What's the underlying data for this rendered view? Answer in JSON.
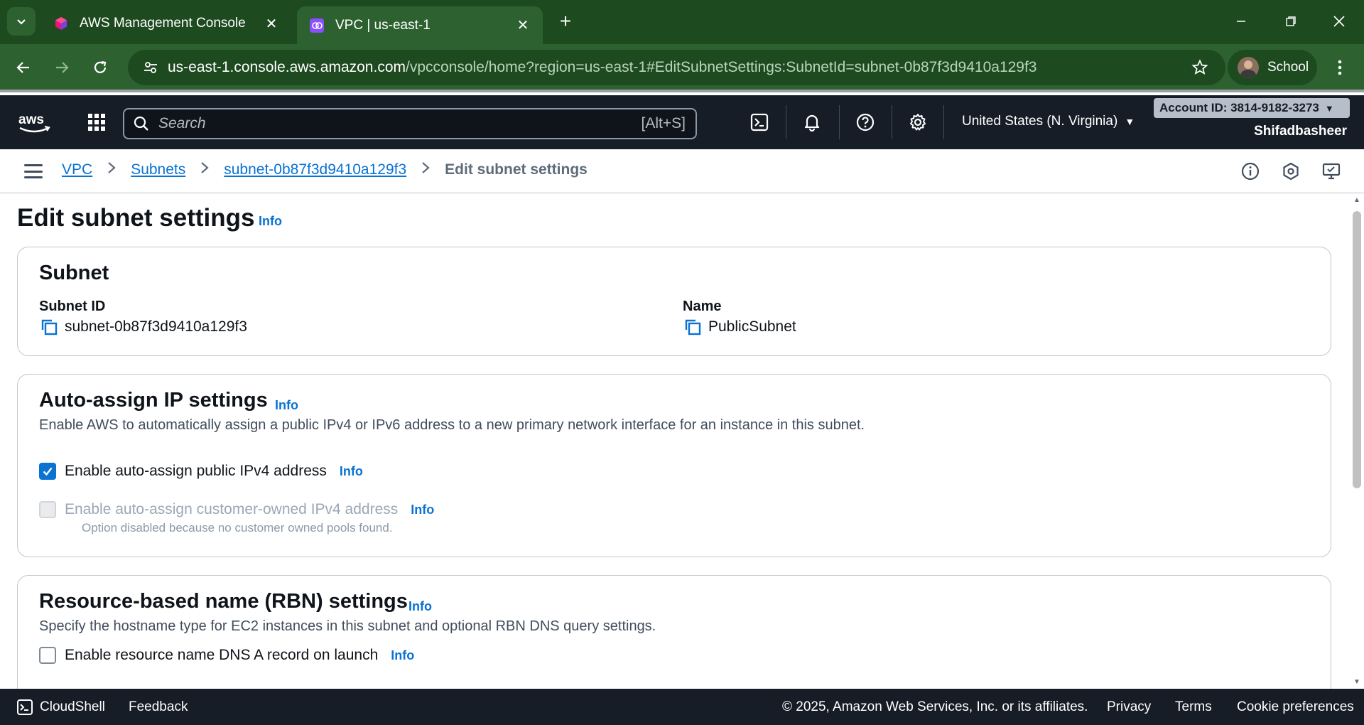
{
  "browser": {
    "tabs": [
      {
        "title": "AWS Management Console",
        "active": false
      },
      {
        "title": "VPC | us-east-1",
        "active": true
      }
    ],
    "url_host": "us-east-1.console.aws.amazon.com",
    "url_path": "/vpcconsole/home?region=us-east-1#EditSubnetSettings:SubnetId=subnet-0b87f3d9410a129f3",
    "profile_name": "School"
  },
  "aws_header": {
    "search_placeholder": "Search",
    "search_shortcut": "[Alt+S]",
    "region": "United States (N. Virginia)",
    "account_id": "Account ID: 3814-9182-3273",
    "username": "Shifadbasheer"
  },
  "breadcrumb": {
    "items": [
      "VPC",
      "Subnets",
      "subnet-0b87f3d9410a129f3"
    ],
    "current": "Edit subnet settings"
  },
  "page": {
    "title": "Edit subnet settings",
    "info": "Info"
  },
  "subnet_card": {
    "heading": "Subnet",
    "subnet_id_label": "Subnet ID",
    "subnet_id_value": "subnet-0b87f3d9410a129f3",
    "name_label": "Name",
    "name_value": "PublicSubnet"
  },
  "auto_assign_card": {
    "heading": "Auto-assign IP settings",
    "info": "Info",
    "description": "Enable AWS to automatically assign a public IPv4 or IPv6 address to a new primary network interface for an instance in this subnet.",
    "ipv4_label": "Enable auto-assign public IPv4 address",
    "ipv4_checked": true,
    "customer_owned_label": "Enable auto-assign customer-owned IPv4 address",
    "customer_owned_helper": "Option disabled because no customer owned pools found."
  },
  "rbn_card": {
    "heading": "Resource-based name (RBN) settings",
    "info": "Info",
    "description": "Specify the hostname type for EC2 instances in this subnet and optional RBN DNS query settings.",
    "dns_a_label": "Enable resource name DNS A record on launch",
    "dns_a_checked": false
  },
  "footer": {
    "cloudshell": "CloudShell",
    "feedback": "Feedback",
    "copyright": "© 2025, Amazon Web Services, Inc. or its affiliates.",
    "privacy": "Privacy",
    "terms": "Terms",
    "cookies": "Cookie preferences"
  },
  "colors": {
    "browser_frame": "#1e4a20",
    "browser_toolbar": "#2d6230",
    "aws_header": "#161d26",
    "link_blue": "#0972d3"
  },
  "icons": [
    "tab-search-icon",
    "aws-cube-icon",
    "vpc-icon",
    "close-icon",
    "plus-icon",
    "minimize-icon",
    "restore-icon",
    "back-icon",
    "forward-icon",
    "reload-icon",
    "site-info-icon",
    "star-icon",
    "kebab-icon",
    "aws-logo",
    "apps-grid-icon",
    "search-icon",
    "cloudshell-icon",
    "bell-icon",
    "help-icon",
    "gear-icon",
    "hamburger-icon",
    "info-circle-icon",
    "security-hexagon-icon",
    "display-icon",
    "copy-icon",
    "check-icon"
  ]
}
